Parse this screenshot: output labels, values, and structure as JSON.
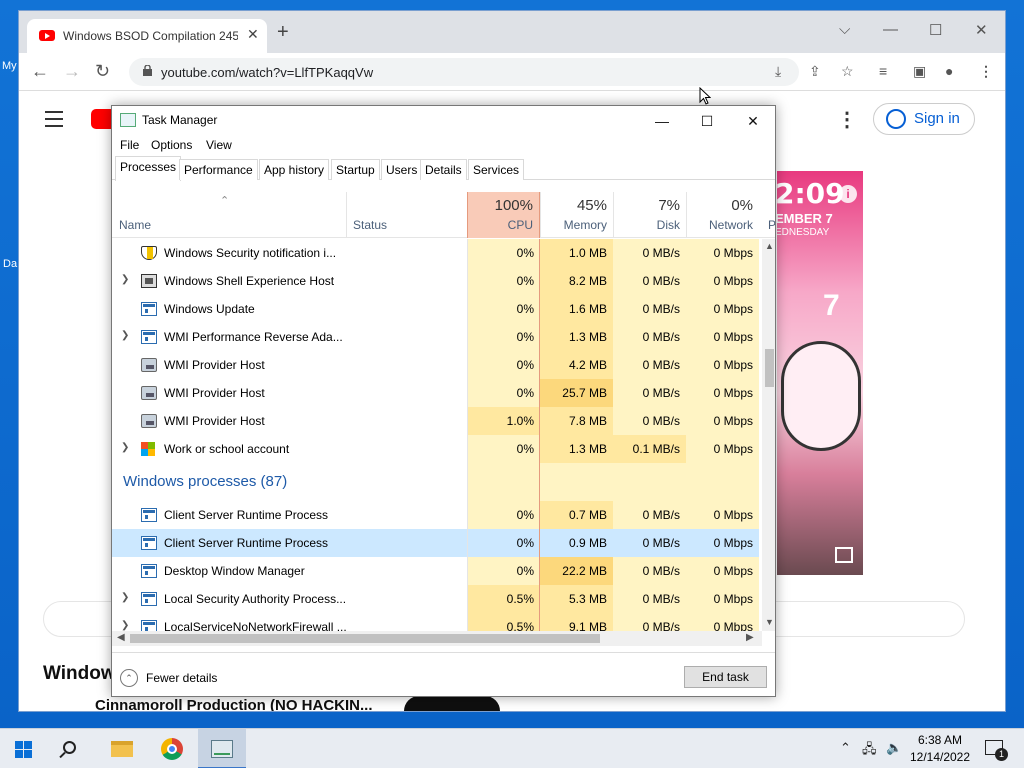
{
  "desktop": {
    "label_my": "My",
    "label_da": "Da"
  },
  "chrome": {
    "tab_title": "Windows BSOD Compilation 245",
    "url": "youtube.com/watch?v=LlfTPKaqqVw"
  },
  "youtube": {
    "sign_in": "Sign in",
    "video_time": "2:09",
    "video_date": "EMBER 7",
    "video_day": "EDNESDAY",
    "video_big_number": "7",
    "section_title": "Windows",
    "channel_title": "Cinnamoroll Production (NO HACKIN..."
  },
  "taskmanager": {
    "title": "Task Manager",
    "menu": [
      "File",
      "Options",
      "View"
    ],
    "tabs": [
      "Processes",
      "Performance",
      "App history",
      "Startup",
      "Users",
      "Details",
      "Services"
    ],
    "columns": {
      "name": "Name",
      "status": "Status",
      "cpu": {
        "pct": "100%",
        "label": "CPU"
      },
      "memory": {
        "pct": "45%",
        "label": "Memory"
      },
      "disk": {
        "pct": "7%",
        "label": "Disk"
      },
      "network": {
        "pct": "0%",
        "label": "Network"
      },
      "partial": "P"
    },
    "rows": [
      {
        "name": "Windows Security notification i...",
        "expand": "",
        "icon": "shield-icon",
        "cpu": "0%",
        "mem": "1.0 MB",
        "disk": "0 MB/s",
        "net": "0 Mbps"
      },
      {
        "name": "Windows Shell Experience Host",
        "expand": ">",
        "icon": "shell-icon",
        "cpu": "0%",
        "mem": "8.2 MB",
        "disk": "0 MB/s",
        "net": "0 Mbps"
      },
      {
        "name": "Windows Update",
        "expand": "",
        "icon": "app-icon",
        "cpu": "0%",
        "mem": "1.6 MB",
        "disk": "0 MB/s",
        "net": "0 Mbps"
      },
      {
        "name": "WMI Performance Reverse Ada...",
        "expand": ">",
        "icon": "app-icon",
        "cpu": "0%",
        "mem": "1.3 MB",
        "disk": "0 MB/s",
        "net": "0 Mbps"
      },
      {
        "name": "WMI Provider Host",
        "expand": "",
        "icon": "wmi-icon",
        "cpu": "0%",
        "mem": "4.2 MB",
        "disk": "0 MB/s",
        "net": "0 Mbps"
      },
      {
        "name": "WMI Provider Host",
        "expand": "",
        "icon": "wmi-icon",
        "cpu": "0%",
        "mem": "25.7 MB",
        "disk": "0 MB/s",
        "net": "0 Mbps"
      },
      {
        "name": "WMI Provider Host",
        "expand": "",
        "icon": "wmi-icon",
        "cpu": "1.0%",
        "mem": "7.8 MB",
        "disk": "0 MB/s",
        "net": "0 Mbps"
      },
      {
        "name": "Work or school account",
        "expand": ">",
        "icon": "microsoft-icon",
        "cpu": "0%",
        "mem": "1.3 MB",
        "disk": "0.1 MB/s",
        "net": "0 Mbps"
      }
    ],
    "group_header": "Windows processes (87)",
    "rows2": [
      {
        "name": "Client Server Runtime Process",
        "expand": "",
        "icon": "app-icon",
        "cpu": "0%",
        "mem": "0.7 MB",
        "disk": "0 MB/s",
        "net": "0 Mbps"
      },
      {
        "name": "Client Server Runtime Process",
        "expand": "",
        "icon": "app-icon",
        "cpu": "0%",
        "mem": "0.9 MB",
        "disk": "0 MB/s",
        "net": "0 Mbps",
        "selected": true
      },
      {
        "name": "Desktop Window Manager",
        "expand": "",
        "icon": "app-icon",
        "cpu": "0%",
        "mem": "22.2 MB",
        "disk": "0 MB/s",
        "net": "0 Mbps"
      },
      {
        "name": "Local Security Authority Process...",
        "expand": ">",
        "icon": "app-icon",
        "cpu": "0.5%",
        "mem": "5.3 MB",
        "disk": "0 MB/s",
        "net": "0 Mbps"
      },
      {
        "name": "LocalServiceNoNetworkFirewall ...",
        "expand": ">",
        "icon": "app-icon",
        "cpu": "0.5%",
        "mem": "9.1 MB",
        "disk": "0 MB/s",
        "net": "0 Mbps"
      }
    ],
    "fewer_details": "Fewer details",
    "end_task": "End task"
  },
  "taskbar": {
    "time": "6:38 AM",
    "date": "12/14/2022",
    "notifications": "1"
  },
  "colors": {
    "cpu_header_bg": "#f7c6b4",
    "cell_light": "#fff4c4",
    "cell_med": "#ffe8a0",
    "cell_strong": "#fcd87c",
    "accent": "#1e5aa8"
  }
}
